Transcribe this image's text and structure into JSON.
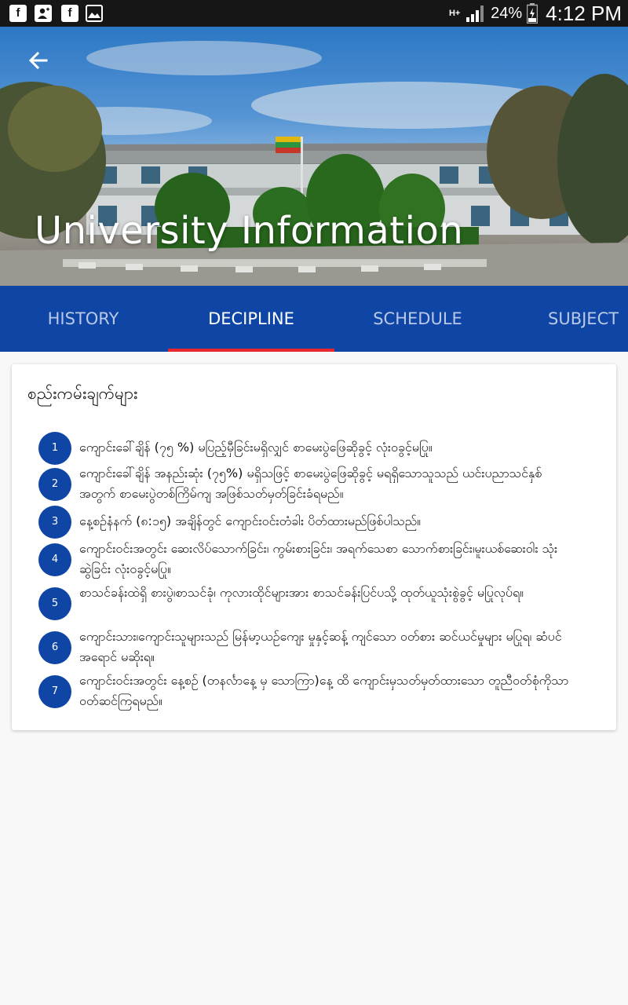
{
  "status_bar": {
    "left_icons": [
      "facebook-icon",
      "person-add-icon",
      "facebook-icon",
      "image-icon"
    ],
    "network_type": "H+",
    "battery_percent": "24%",
    "time": "4:12 PM"
  },
  "header": {
    "title": "University Information",
    "back_icon": "arrow-left-icon"
  },
  "tabs": [
    {
      "label": "HISTORY",
      "active": false
    },
    {
      "label": "DECIPLINE",
      "active": true
    },
    {
      "label": "SCHEDULE",
      "active": false
    },
    {
      "label": "SUBJECT",
      "active": false
    }
  ],
  "card": {
    "title": "စည်းကမ်းချက်များ",
    "rules": [
      {
        "number": "1",
        "text": "ကျောင်းခေါ်ချိန် (၇၅ %) မပြည့်မှီခြင်းမရှိလျှင် စာမေးပွဲဖြေဆိုခွင့် လုံးဝခွင့်မပြု။"
      },
      {
        "number": "2",
        "text": "ကျောင်းခေါ်ချိန် အနည်းဆုံး (၇၅%) မရှိသဖြင့် စာမေးပွဲဖြေဆိုခွင့် မရရှိသောသူသည် ယင်းပညာသင်နှစ် အတွက် စာမေးပွဲတစ်ကြိမ်ကျ အဖြစ်သတ်မှတ်ခြင်းခံရမည်။"
      },
      {
        "number": "3",
        "text": "နေ့စဉ်နံနက် (၈:၁၅) အချိန်တွင် ကျောင်းဝင်းတံခါး ပိတ်ထားမည်ဖြစ်ပါသည်။"
      },
      {
        "number": "4",
        "text": "ကျောင်းဝင်းအတွင်း ဆေးလိပ်သောက်ခြင်း၊ ကွမ်းစားခြင်း၊ အရက်သေစာ သောက်စားခြင်း၊မူးယစ်ဆေးဝါး သုံးဆွဲခြင်း လုံးဝခွင့်မပြု။"
      },
      {
        "number": "5",
        "text": "စာသင်ခန်းထဲရှိ စားပွဲ၊စာသင်ခုံ၊ ကုလားထိုင်များအား စာသင်ခန်းပြင်ပသို့ ထုတ်ယူသုံးစွဲခွင့် မပြုလုပ်ရ။"
      },
      {
        "number": "6",
        "text": "ကျောင်းသား၊ကျောင်းသူများသည် မြန်မာ့ယဉ်ကျေး မှုနှင့်ဆန့် ကျင်သော ဝတ်စား ဆင်ယင်မှုများ မပြုရ၊ ဆံပင်အရောင် မဆိုးရ။"
      },
      {
        "number": "7",
        "text": "ကျောင်းဝင်းအတွင်း နေ့စဉ် (တနင်္လာနေ့ မှ သောကြာ)နေ့ ထိ ကျောင်းမှသတ်မှတ်ထားသော တူညီဝတ်စုံကိုသာ ဝတ်ဆင်ကြရမည်။"
      }
    ]
  },
  "colors": {
    "primary": "#0f46a6",
    "tab_indicator": "#e7262e",
    "status_bar": "#161616",
    "background": "#f8f8f9"
  }
}
